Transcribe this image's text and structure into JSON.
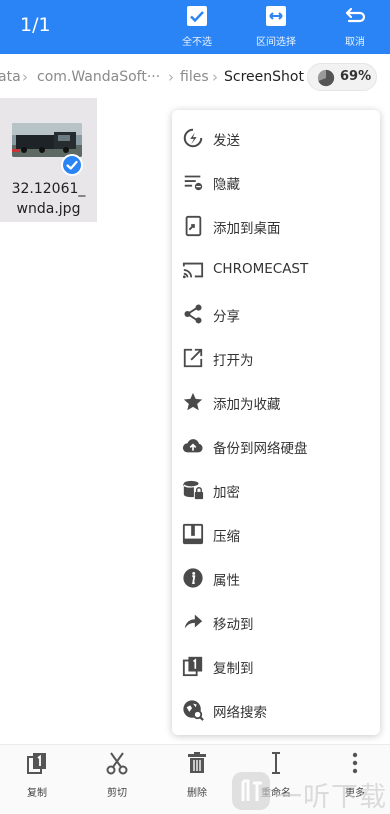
{
  "header": {
    "selection_count": "1/1",
    "actions": [
      {
        "label": "全不选",
        "icon": "checkbox-icon"
      },
      {
        "label": "区间选择",
        "icon": "range-select-icon"
      },
      {
        "label": "取消",
        "icon": "return-icon"
      }
    ]
  },
  "breadcrumb": {
    "items": [
      "ata",
      "com.WandaSoft···",
      "files",
      "ScreenShot"
    ],
    "separator": "›"
  },
  "storage": {
    "percent_label": "69%",
    "used_fraction": 0.69
  },
  "file": {
    "name_line1": "32.12061_",
    "name_line2": "wnda.jpg",
    "selected": true
  },
  "menu": {
    "items": [
      {
        "label": "发送",
        "icon": "send-icon"
      },
      {
        "label": "隐藏",
        "icon": "hide-icon"
      },
      {
        "label": "添加到桌面",
        "icon": "add-to-desktop-icon"
      },
      {
        "label": "CHROMECAST",
        "icon": "cast-icon"
      },
      {
        "label": "分享",
        "icon": "share-icon"
      },
      {
        "label": "打开为",
        "icon": "open-as-icon"
      },
      {
        "label": "添加为收藏",
        "icon": "star-icon"
      },
      {
        "label": "备份到网络硬盘",
        "icon": "cloud-upload-icon"
      },
      {
        "label": "加密",
        "icon": "lock-icon"
      },
      {
        "label": "压缩",
        "icon": "archive-icon"
      },
      {
        "label": "属性",
        "icon": "info-icon"
      },
      {
        "label": "移动到",
        "icon": "move-icon"
      },
      {
        "label": "复制到",
        "icon": "copy-to-icon"
      },
      {
        "label": "网络搜索",
        "icon": "web-search-icon"
      }
    ]
  },
  "bottom_bar": {
    "items": [
      {
        "label": "复制",
        "icon": "copy-icon"
      },
      {
        "label": "剪切",
        "icon": "scissors-icon"
      },
      {
        "label": "删除",
        "icon": "trash-icon"
      },
      {
        "label": "重命名",
        "icon": "text-cursor-icon"
      },
      {
        "label": "更多",
        "icon": "more-vertical-icon"
      }
    ]
  },
  "watermark": {
    "text": "一听下载"
  },
  "colors": {
    "accent": "#2a84f6",
    "menu_icon": "#4a4a4a",
    "tile_selected": "#e9e6ea"
  }
}
